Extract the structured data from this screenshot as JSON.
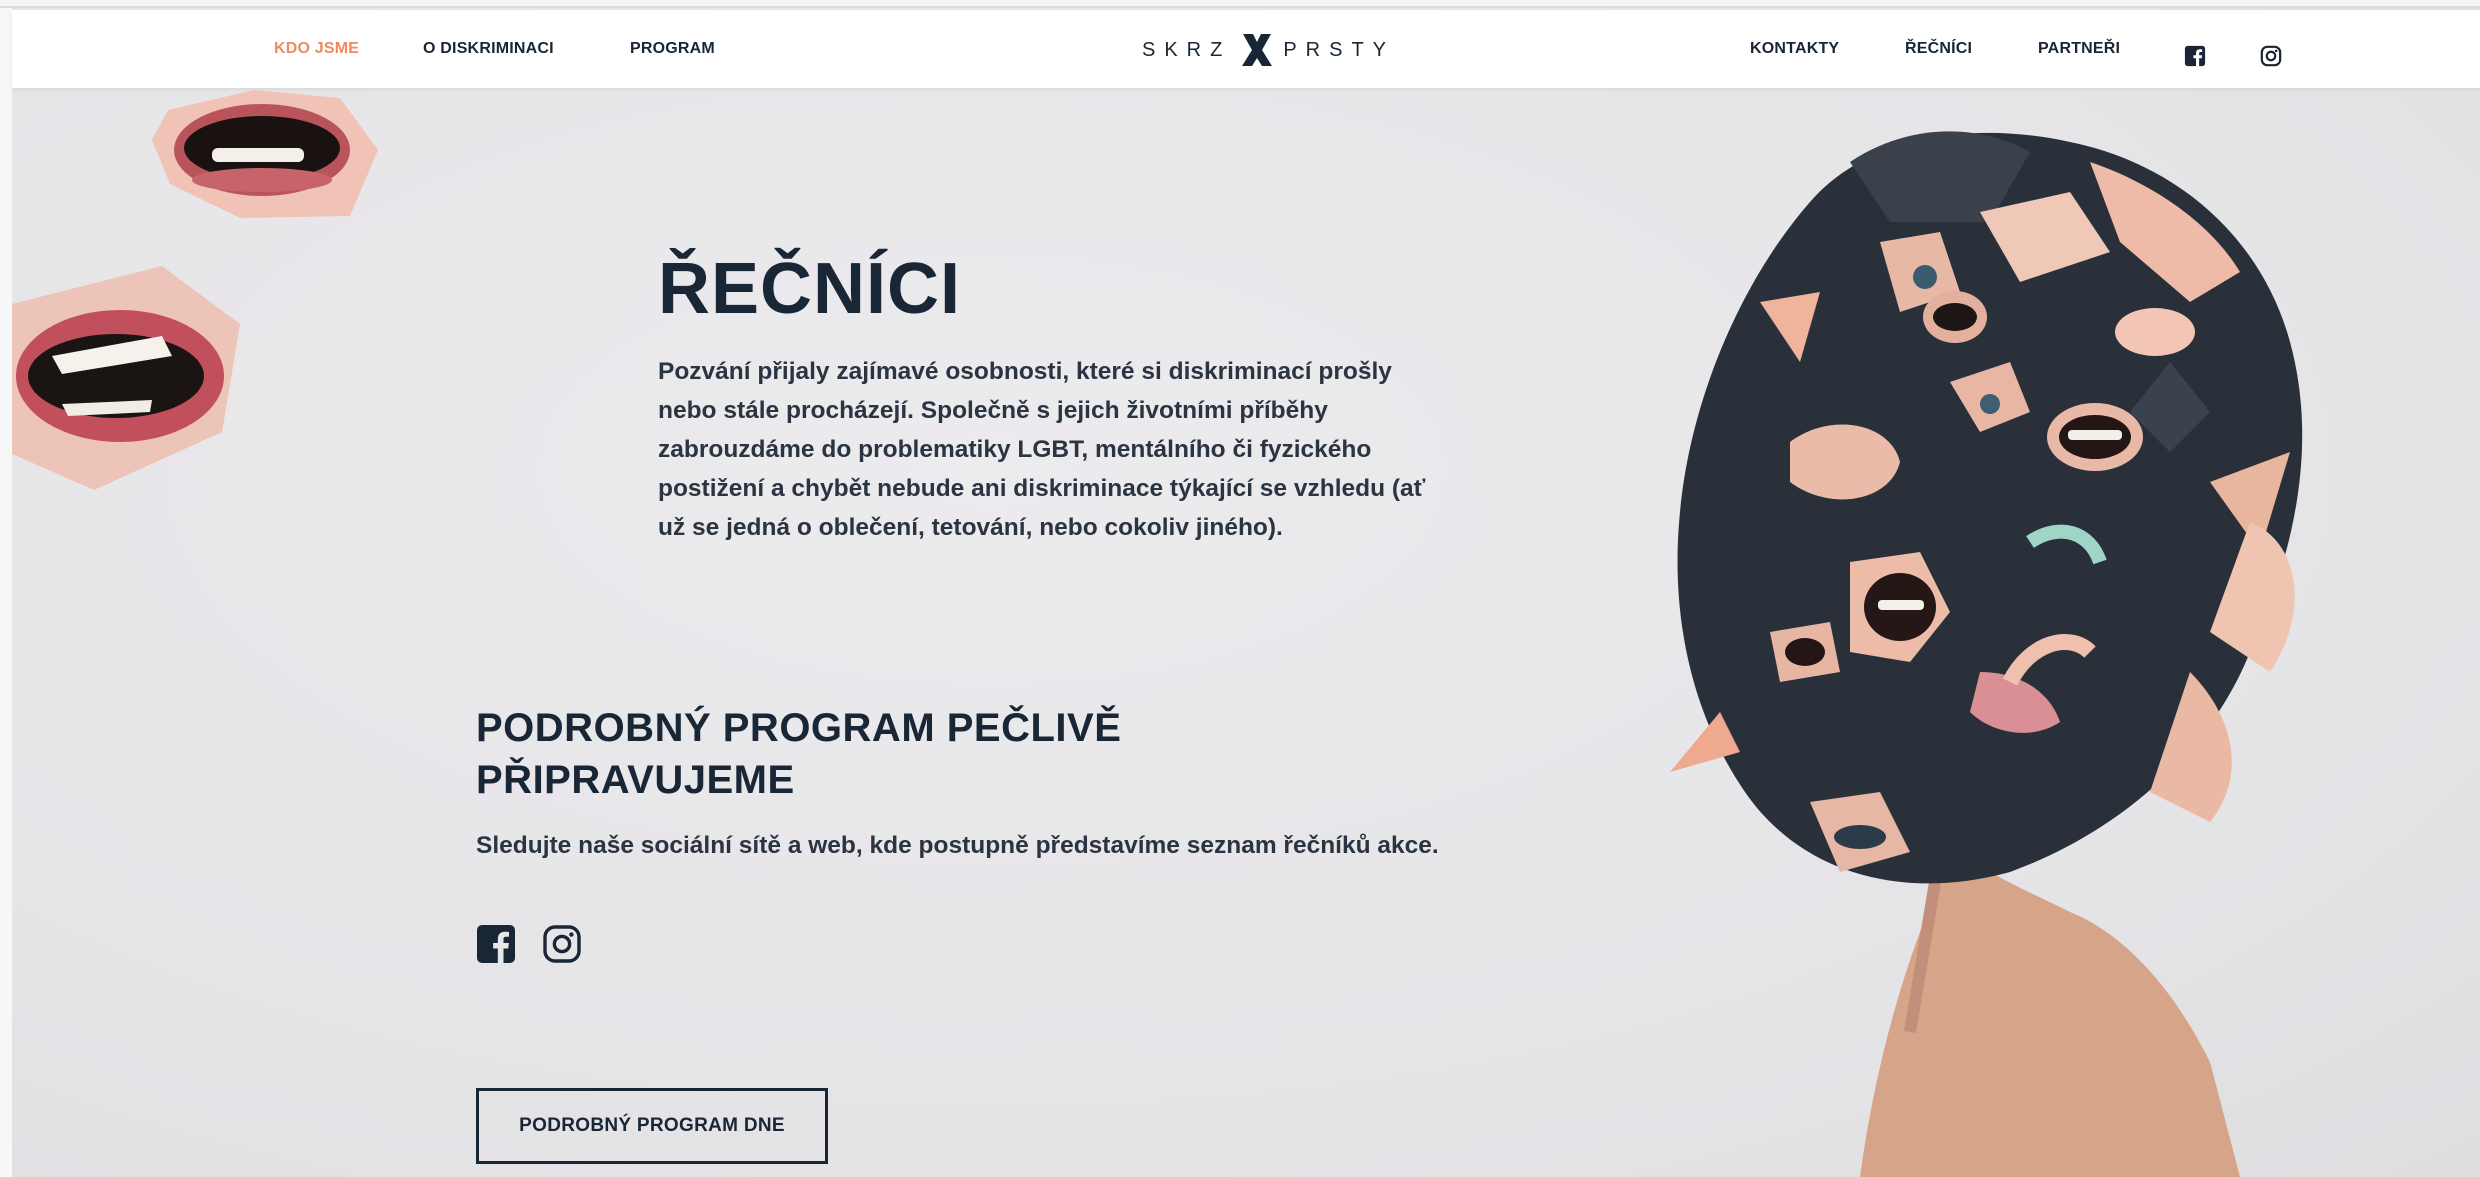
{
  "nav": {
    "left_items": [
      {
        "label": "KDO JSME",
        "active": true
      },
      {
        "label": "O DISKRIMINACI",
        "active": false
      },
      {
        "label": "PROGRAM",
        "active": false
      }
    ],
    "logo": {
      "left": "SKRZ",
      "right": "PRSTY"
    },
    "right_items": [
      {
        "label": "KONTAKTY"
      },
      {
        "label": "ŘEČNÍCI"
      },
      {
        "label": "PARTNEŘI"
      }
    ],
    "social_icons": [
      "facebook-icon",
      "instagram-icon"
    ]
  },
  "speakers": {
    "title": "ŘEČNÍCI",
    "intro": "Pozvání přijaly zajímavé osobnosti, které si diskriminací prošly nebo stále procházejí. Společně s jejich životními příběhy zabrouzdáme do problematiky LGBT, mentálního či fyzického postižení a chybět nebude ani diskriminace týkající se vzhledu (ať už se jedná o oblečení, tetování, nebo cokoliv jiného)."
  },
  "program": {
    "title": "PODROBNÝ PROGRAM PEČLIVĚ PŘIPRAVUJEME",
    "text": "Sledujte naše sociální sítě a web, kde postupně představíme seznam řečníků akce.",
    "social_icons": [
      "facebook-icon",
      "instagram-icon"
    ],
    "button_label": "PODROBNÝ PROGRAM DNE"
  },
  "colors": {
    "accent": "#f08a5c",
    "text": "#182635",
    "background": "#e7e6e9"
  }
}
